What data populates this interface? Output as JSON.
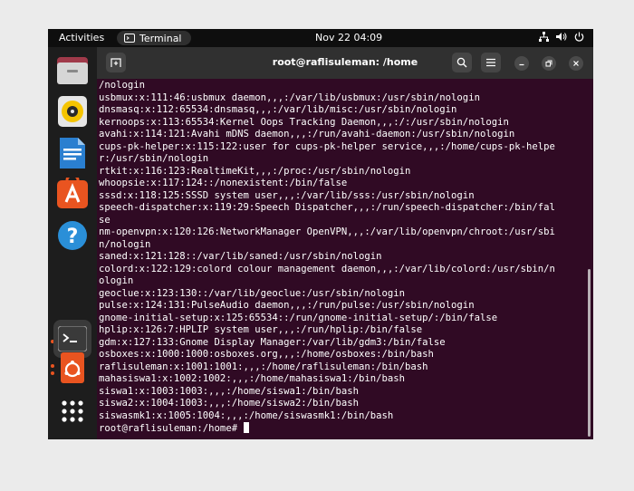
{
  "topbar": {
    "activities": "Activities",
    "app_name": "Terminal",
    "datetime": "Nov 22  04:09"
  },
  "window": {
    "title": "root@raflisuleman: /home"
  },
  "dock": {
    "items": [
      {
        "name": "files",
        "running": false
      },
      {
        "name": "rhythmbox",
        "running": false
      },
      {
        "name": "writer",
        "running": false
      },
      {
        "name": "software",
        "running": false
      },
      {
        "name": "help",
        "running": false
      },
      {
        "name": "terminal",
        "running": true,
        "active": true
      },
      {
        "name": "ubuntu-installer",
        "running": true
      },
      {
        "name": "show-apps",
        "running": false
      }
    ]
  },
  "terminal": {
    "lines": [
      "/nologin",
      "usbmux:x:111:46:usbmux daemon,,,:/var/lib/usbmux:/usr/sbin/nologin",
      "dnsmasq:x:112:65534:dnsmasq,,,:/var/lib/misc:/usr/sbin/nologin",
      "kernoops:x:113:65534:Kernel Oops Tracking Daemon,,,:/:/usr/sbin/nologin",
      "avahi:x:114:121:Avahi mDNS daemon,,,:/run/avahi-daemon:/usr/sbin/nologin",
      "cups-pk-helper:x:115:122:user for cups-pk-helper service,,,:/home/cups-pk-helpe",
      "r:/usr/sbin/nologin",
      "rtkit:x:116:123:RealtimeKit,,,:/proc:/usr/sbin/nologin",
      "whoopsie:x:117:124::/nonexistent:/bin/false",
      "sssd:x:118:125:SSSD system user,,,:/var/lib/sss:/usr/sbin/nologin",
      "speech-dispatcher:x:119:29:Speech Dispatcher,,,:/run/speech-dispatcher:/bin/fal",
      "se",
      "nm-openvpn:x:120:126:NetworkManager OpenVPN,,,:/var/lib/openvpn/chroot:/usr/sbi",
      "n/nologin",
      "saned:x:121:128::/var/lib/saned:/usr/sbin/nologin",
      "colord:x:122:129:colord colour management daemon,,,:/var/lib/colord:/usr/sbin/n",
      "ologin",
      "geoclue:x:123:130::/var/lib/geoclue:/usr/sbin/nologin",
      "pulse:x:124:131:PulseAudio daemon,,,:/run/pulse:/usr/sbin/nologin",
      "gnome-initial-setup:x:125:65534::/run/gnome-initial-setup/:/bin/false",
      "hplip:x:126:7:HPLIP system user,,,:/run/hplip:/bin/false",
      "gdm:x:127:133:Gnome Display Manager:/var/lib/gdm3:/bin/false",
      "osboxes:x:1000:1000:osboxes.org,,,:/home/osboxes:/bin/bash",
      "raflisuleman:x:1001:1001:,,,:/home/raflisuleman:/bin/bash",
      "mahasiswa1:x:1002:1002:,,,:/home/mahasiswa1:/bin/bash",
      "siswa1:x:1003:1003:,,,:/home/siswa1:/bin/bash",
      "siswa2:x:1004:1003:,,,:/home/siswa2:/bin/bash",
      "siswasmk1:x:1005:1004:,,,:/home/siswasmk1:/bin/bash"
    ],
    "prompt": "root@raflisuleman:/home# "
  }
}
